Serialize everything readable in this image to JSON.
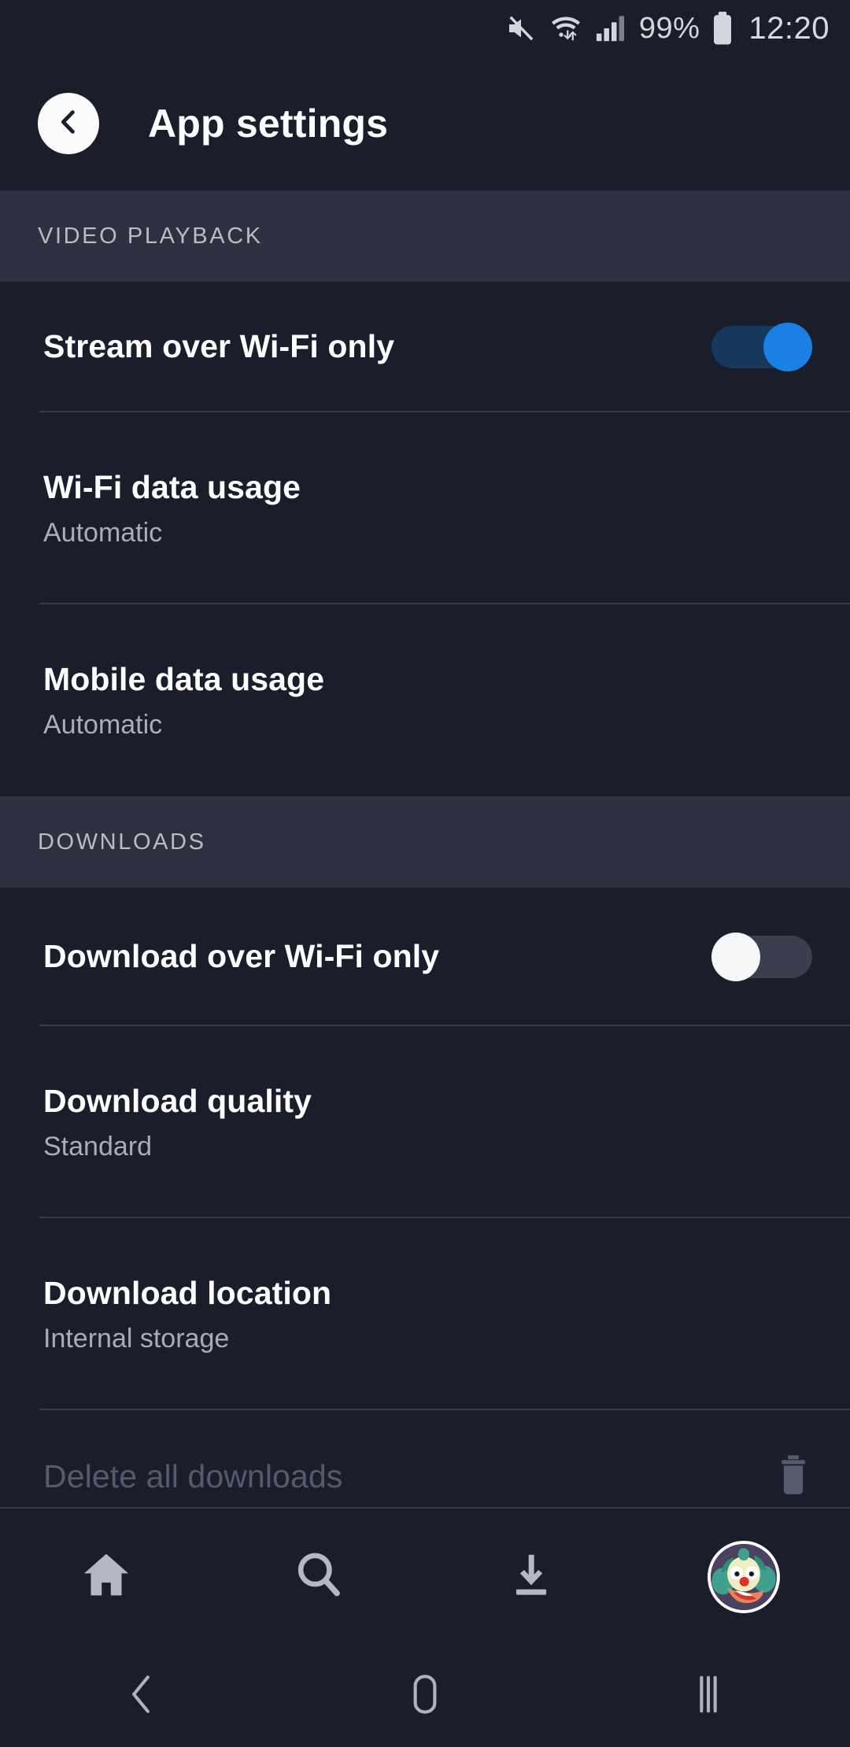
{
  "status_bar": {
    "icons": [
      "volume-mute-icon",
      "wifi-icon",
      "signal-icon",
      "battery-icon"
    ],
    "battery_percent": "99%",
    "clock": "12:20"
  },
  "app_bar": {
    "back_icon": "chevron-left-icon",
    "title": "App settings"
  },
  "sections": [
    {
      "header": "VIDEO PLAYBACK",
      "rows": [
        {
          "title": "Stream over Wi-Fi only",
          "subtitle": "",
          "control": "toggle",
          "toggle_state": "on"
        },
        {
          "title": "Wi-Fi data usage",
          "subtitle": "Automatic",
          "control": "none",
          "toggle_state": ""
        },
        {
          "title": "Mobile data usage",
          "subtitle": "Automatic",
          "control": "none",
          "toggle_state": ""
        }
      ]
    },
    {
      "header": "DOWNLOADS",
      "rows": [
        {
          "title": "Download over Wi-Fi only",
          "subtitle": "",
          "control": "toggle",
          "toggle_state": "off"
        },
        {
          "title": "Download quality",
          "subtitle": "Standard",
          "control": "none",
          "toggle_state": ""
        },
        {
          "title": "Download location",
          "subtitle": "Internal storage",
          "control": "none",
          "toggle_state": ""
        },
        {
          "title": "Delete all downloads",
          "subtitle": "",
          "control": "trash",
          "toggle_state": ""
        }
      ]
    }
  ],
  "bottom_nav": {
    "items": [
      {
        "icon": "home-icon",
        "label": ""
      },
      {
        "icon": "search-icon",
        "label": ""
      },
      {
        "icon": "download-icon",
        "label": ""
      },
      {
        "icon": "profile-avatar",
        "label": ""
      }
    ]
  },
  "system_nav": {
    "items": [
      {
        "icon": "system-back-icon"
      },
      {
        "icon": "system-home-icon"
      },
      {
        "icon": "system-recents-icon"
      }
    ]
  },
  "colors": {
    "background": "#1a1d2a",
    "section_header_bg": "#2e3240",
    "accent_blue": "#1b80e3",
    "toggle_on_track": "#15395e",
    "toggle_off_track": "#3b3f4d",
    "divider": "#383c4a",
    "title_text": "#ffffff",
    "subtitle_text": "#a9adb8",
    "dim_text": "#565b6b"
  }
}
